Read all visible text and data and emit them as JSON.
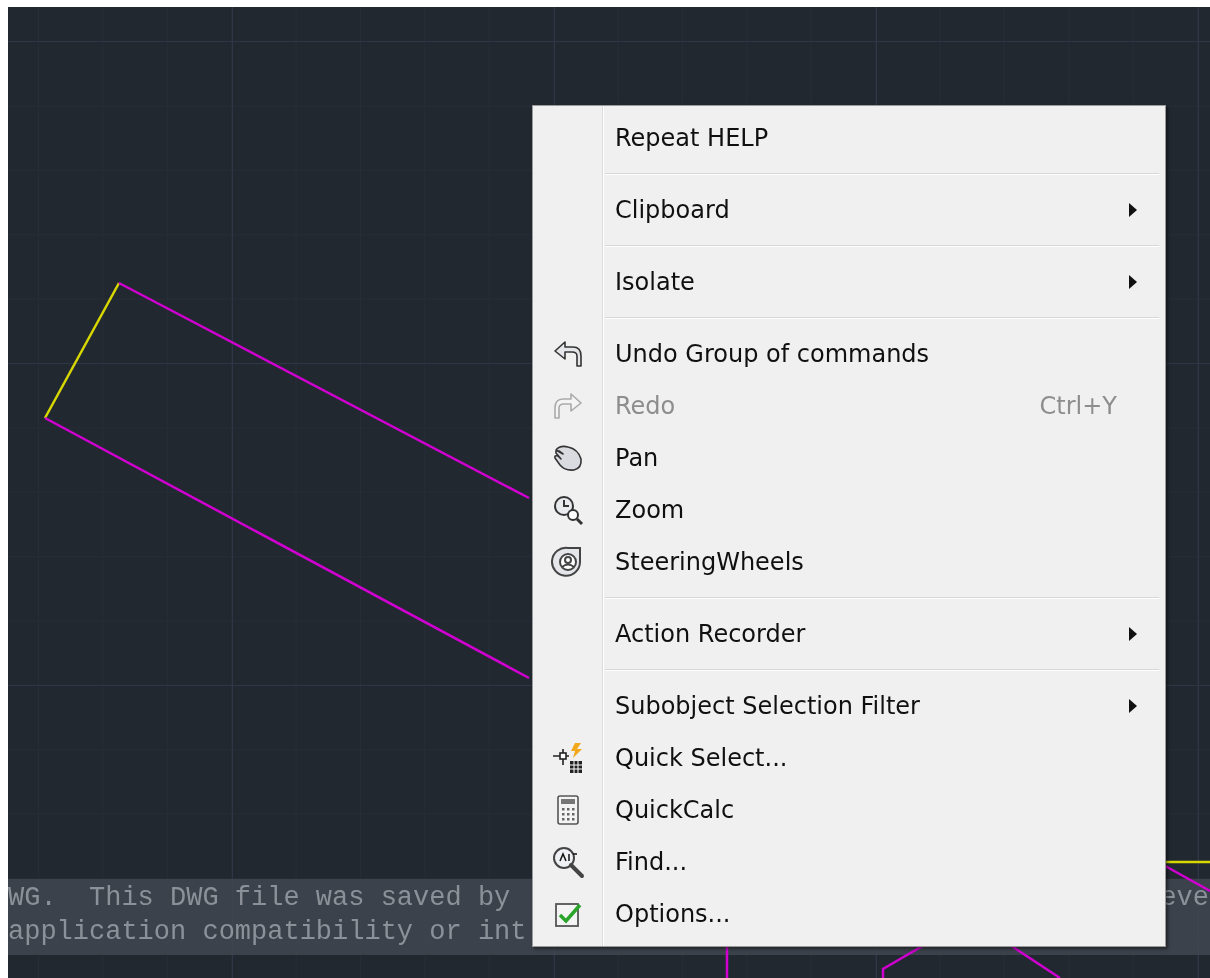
{
  "command_line": {
    "lines": [
      {
        "text": "WG.  This DWG file was saved by ",
        "tail": "eve"
      },
      {
        "text": "application compatibility or int"
      }
    ]
  },
  "context_menu": {
    "groups": [
      {
        "items": [
          {
            "label": "Repeat HELP",
            "kind": "plain",
            "disabled": false,
            "submenu": false
          }
        ]
      },
      {
        "items": [
          {
            "label": "Clipboard",
            "kind": "plain",
            "disabled": false,
            "submenu": true
          }
        ]
      },
      {
        "items": [
          {
            "label": "Isolate",
            "kind": "plain",
            "disabled": false,
            "submenu": true
          }
        ]
      },
      {
        "items": [
          {
            "label": "Undo Group of commands",
            "kind": "undo",
            "disabled": false,
            "submenu": false
          },
          {
            "label": "Redo",
            "kind": "redo",
            "disabled": true,
            "submenu": false,
            "shortcut": "Ctrl+Y"
          },
          {
            "label": "Pan",
            "kind": "pan",
            "disabled": false,
            "submenu": false
          },
          {
            "label": "Zoom",
            "kind": "zoom",
            "disabled": false,
            "submenu": false
          },
          {
            "label": "SteeringWheels",
            "kind": "wheel",
            "disabled": false,
            "submenu": false
          }
        ]
      },
      {
        "items": [
          {
            "label": "Action Recorder",
            "kind": "plain",
            "disabled": false,
            "submenu": true
          }
        ]
      },
      {
        "items": [
          {
            "label": "Subobject Selection Filter",
            "kind": "plain",
            "disabled": false,
            "submenu": true
          },
          {
            "label": "Quick Select...",
            "kind": "quickselect",
            "disabled": false,
            "submenu": false
          },
          {
            "label": "QuickCalc",
            "kind": "calculator",
            "disabled": false,
            "submenu": false
          },
          {
            "label": "Find...",
            "kind": "find",
            "disabled": false,
            "submenu": false
          },
          {
            "label": "Options...",
            "kind": "options",
            "disabled": false,
            "submenu": false
          }
        ]
      }
    ]
  }
}
